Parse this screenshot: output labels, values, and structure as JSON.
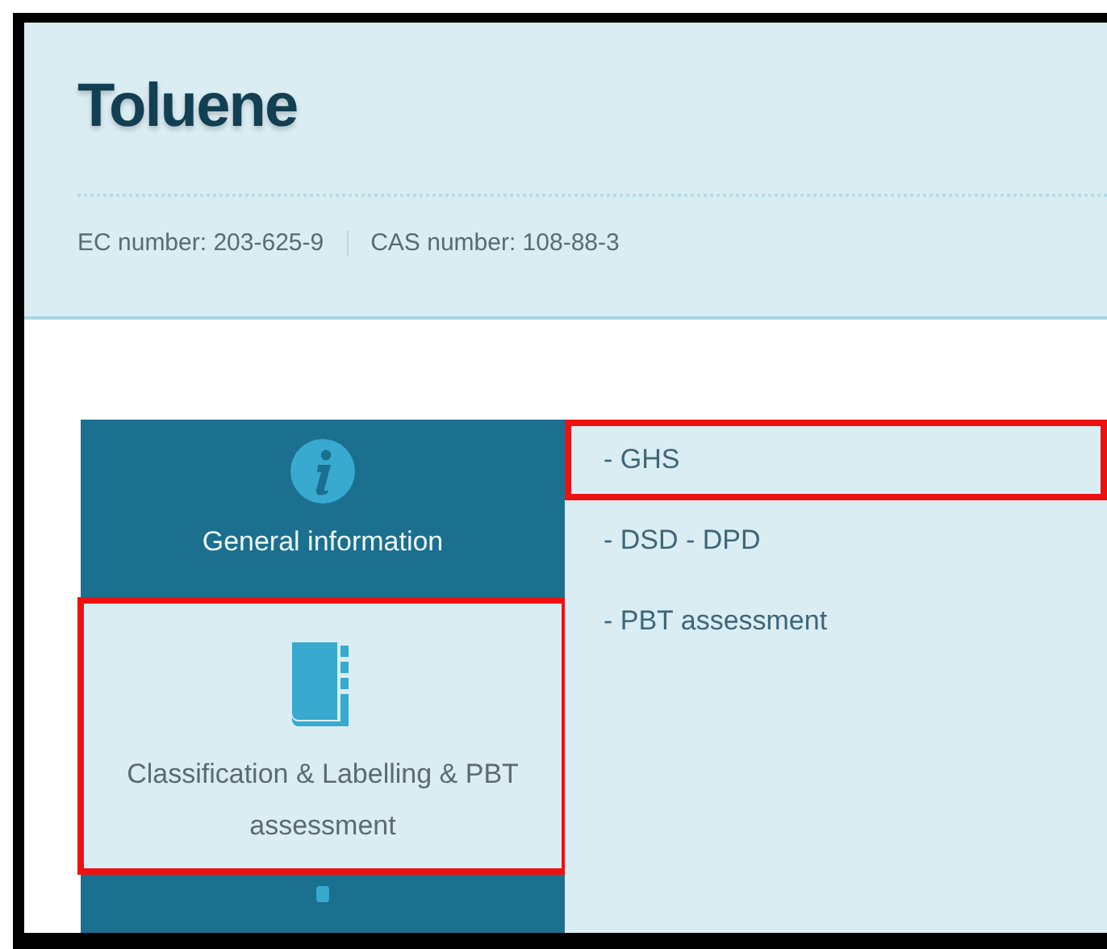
{
  "substance": {
    "title": "Toluene",
    "identifiers": [
      {
        "label": "EC number: 203-625-9"
      },
      {
        "label": "CAS number: 108-88-3"
      }
    ]
  },
  "tabs": [
    {
      "kind": "info",
      "label": "General information",
      "selected": false,
      "highlighted": false
    },
    {
      "kind": "book",
      "label": "Classification & Labelling & PBT assessment",
      "selected": true,
      "highlighted": true
    },
    {
      "kind": "partial",
      "selected": false,
      "highlighted": false
    }
  ],
  "submenu": [
    {
      "label": "- GHS",
      "highlighted": true
    },
    {
      "label": "- DSD - DPD",
      "highlighted": false
    },
    {
      "label": "- PBT assessment",
      "highlighted": false
    }
  ]
}
